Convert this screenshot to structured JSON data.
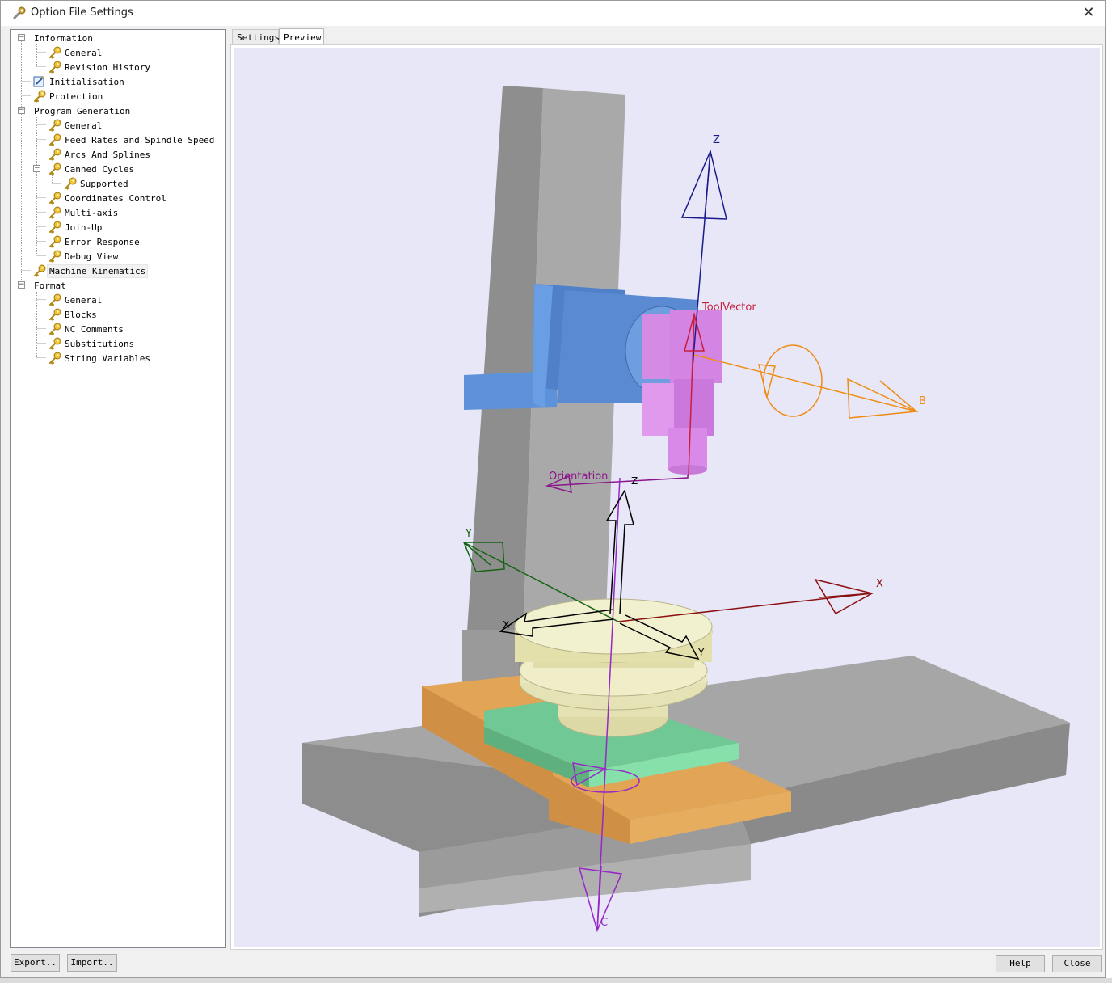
{
  "window": {
    "title": "Option File Settings",
    "close_symbol": "✕"
  },
  "tree": {
    "items": [
      {
        "label": "Information",
        "level": 0,
        "expander": "−",
        "icon": "none"
      },
      {
        "label": "General",
        "level": 1,
        "icon": "key-icon"
      },
      {
        "label": "Revision History",
        "level": 1,
        "icon": "key-icon"
      },
      {
        "label": "Initialisation",
        "level": 0,
        "icon": "edit-icon"
      },
      {
        "label": "Protection",
        "level": 0,
        "icon": "key-icon"
      },
      {
        "label": "Program Generation",
        "level": 0,
        "expander": "−",
        "icon": "none"
      },
      {
        "label": "General",
        "level": 1,
        "icon": "key-icon"
      },
      {
        "label": "Feed Rates and Spindle Speed",
        "level": 1,
        "icon": "key-icon"
      },
      {
        "label": "Arcs And Splines",
        "level": 1,
        "icon": "key-icon"
      },
      {
        "label": "Canned Cycles",
        "level": 1,
        "expander": "−",
        "icon": "key-icon"
      },
      {
        "label": "Supported",
        "level": 2,
        "icon": "key-icon"
      },
      {
        "label": "Coordinates Control",
        "level": 1,
        "icon": "key-icon"
      },
      {
        "label": "Multi-axis",
        "level": 1,
        "icon": "key-icon"
      },
      {
        "label": "Join-Up",
        "level": 1,
        "icon": "key-icon"
      },
      {
        "label": "Error Response",
        "level": 1,
        "icon": "key-icon"
      },
      {
        "label": "Debug View",
        "level": 1,
        "icon": "key-icon"
      },
      {
        "label": "Machine Kinematics",
        "level": 0,
        "icon": "key-icon",
        "selected": true
      },
      {
        "label": "Format",
        "level": 0,
        "expander": "−",
        "icon": "none"
      },
      {
        "label": "General",
        "level": 1,
        "icon": "key-icon"
      },
      {
        "label": "Blocks",
        "level": 1,
        "icon": "key-icon"
      },
      {
        "label": "NC Comments",
        "level": 1,
        "icon": "key-icon"
      },
      {
        "label": "Substitutions",
        "level": 1,
        "icon": "key-icon"
      },
      {
        "label": "String Variables",
        "level": 1,
        "icon": "key-icon"
      }
    ]
  },
  "tabs": {
    "settings": "Settings",
    "preview": "Preview",
    "active": "preview"
  },
  "viewport": {
    "background": "#e7e7f8",
    "labels": {
      "tool_z": "Z",
      "tool_vector": "ToolVector",
      "b_axis": "B",
      "orientation": "Orientation",
      "origin_z": "Z",
      "y_axis": "Y",
      "x_axis": "X",
      "origin_x": "X",
      "origin_y": "Y",
      "c_axis": "C"
    },
    "colors": {
      "column": "#9c9c9c",
      "head": "#5b8fd6",
      "spindle": "#d98ae6",
      "table": "#8c8c8c",
      "saddle": "#e0a050",
      "rotary_plate": "#7fdca4",
      "rotary_table": "#e6e3b2",
      "z_axis": "#1a1a8c",
      "x_axis": "#8c1010",
      "y_axis": "#146414",
      "b_axis": "#f08c14",
      "tool_vector": "#c81e3c",
      "orientation": "#8c148c",
      "c_axis": "#9628c8"
    }
  },
  "buttons": {
    "export": "Export..",
    "import": "Import..",
    "help": "Help",
    "close": "Close"
  }
}
